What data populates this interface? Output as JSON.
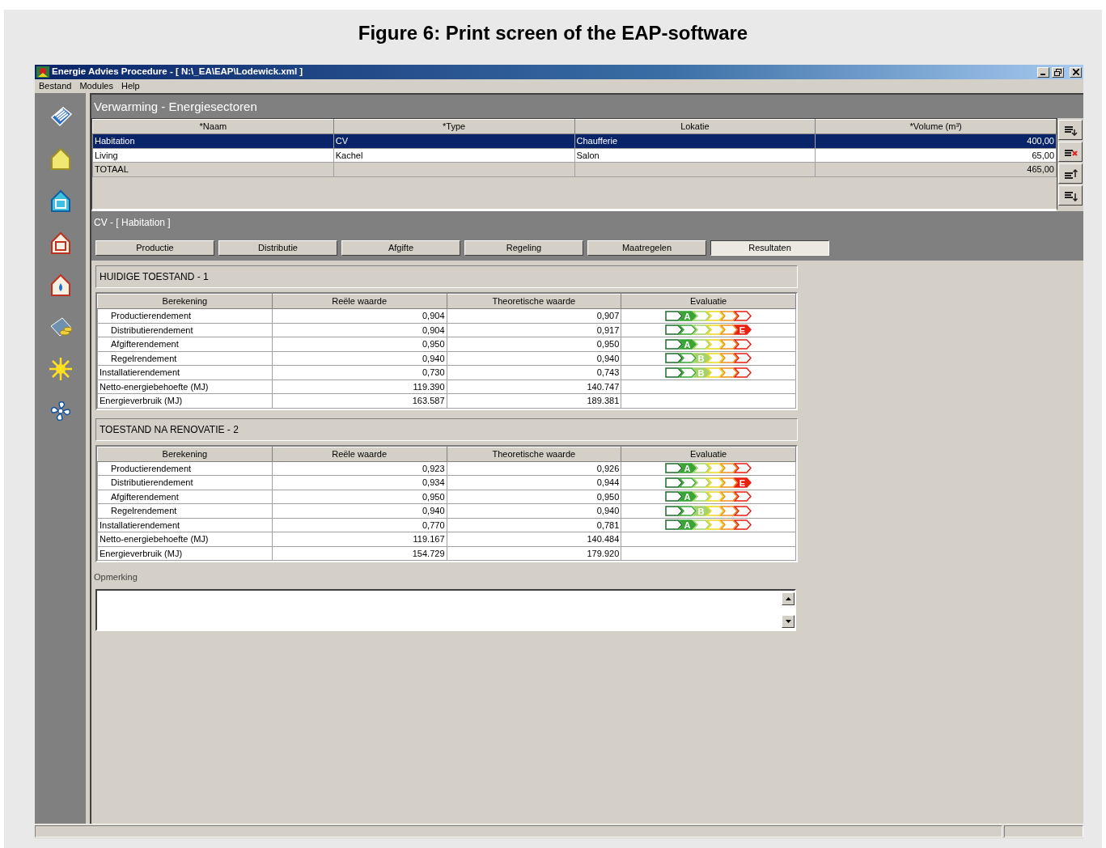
{
  "figure_caption": "Figure 6: Print screen of the EAP-software",
  "window": {
    "title": "Energie Advies Procedure - [ N:\\_EA\\EAP\\Lodewick.xml ]"
  },
  "menu": [
    "Bestand",
    "Modules",
    "Help"
  ],
  "sidebar": {
    "items": [
      {
        "kind": "cards"
      },
      {
        "kind": "house"
      },
      {
        "kind": "house-frame"
      },
      {
        "kind": "house-red"
      },
      {
        "kind": "house-drop"
      },
      {
        "kind": "coins"
      },
      {
        "kind": "sun"
      },
      {
        "kind": "fan"
      }
    ]
  },
  "sector_panel": {
    "title": "Verwarming - Energiesectoren",
    "columns": [
      "*Naam",
      "*Type",
      "Lokatie",
      "*Volume (m³)"
    ],
    "rows": [
      {
        "kind": "data",
        "selected": true,
        "cells": [
          "Habitation",
          "CV",
          "Chaufferie",
          "400,00"
        ]
      },
      {
        "kind": "data",
        "selected": false,
        "cells": [
          "Living",
          "Kachel",
          "Salon",
          "65,00"
        ]
      },
      {
        "kind": "total",
        "selected": false,
        "cells": [
          "TOTAAL",
          "",
          "",
          "465,00"
        ]
      }
    ],
    "toolbar": [
      {
        "kind": "add"
      },
      {
        "kind": "delete"
      },
      {
        "kind": "up"
      },
      {
        "kind": "down"
      }
    ]
  },
  "detail": {
    "title": "CV - [ Habitation ]",
    "tabs": [
      {
        "label": "Productie",
        "selected": false
      },
      {
        "label": "Distributie",
        "selected": false
      },
      {
        "label": "Afgifte",
        "selected": false
      },
      {
        "label": "Regeling",
        "selected": false
      },
      {
        "label": "Maatregelen",
        "selected": false
      },
      {
        "label": "Resultaten",
        "selected": true
      }
    ]
  },
  "sections": [
    {
      "title": "HUIDIGE TOESTAND - 1",
      "columns": [
        "Berekening",
        "Reële waarde",
        "Theoretische waarde",
        "Evaluatie"
      ],
      "rows": [
        {
          "kind": "sub",
          "cells": [
            "Productierendement",
            "0,904",
            "0,907"
          ],
          "evaluation": [
            {
              "selected": false
            },
            {
              "selected": true,
              "label": "A"
            },
            {
              "selected": false
            },
            {
              "selected": false
            },
            {
              "selected": false
            },
            {
              "selected": false
            }
          ]
        },
        {
          "kind": "sub",
          "cells": [
            "Distributierendement",
            "0,904",
            "0,917"
          ],
          "evaluation": [
            {
              "selected": false
            },
            {
              "selected": false
            },
            {
              "selected": false
            },
            {
              "selected": false
            },
            {
              "selected": false
            },
            {
              "selected": true,
              "label": "E"
            }
          ]
        },
        {
          "kind": "sub",
          "cells": [
            "Afgifterendement",
            "0,950",
            "0,950"
          ],
          "evaluation": [
            {
              "selected": false
            },
            {
              "selected": true,
              "label": "A"
            },
            {
              "selected": false
            },
            {
              "selected": false
            },
            {
              "selected": false
            },
            {
              "selected": false
            }
          ]
        },
        {
          "kind": "sub",
          "cells": [
            "Regelrendement",
            "0,940",
            "0,940"
          ],
          "evaluation": [
            {
              "selected": false
            },
            {
              "selected": false
            },
            {
              "selected": true,
              "label": "B"
            },
            {
              "selected": false
            },
            {
              "selected": false
            },
            {
              "selected": false
            }
          ]
        },
        {
          "kind": "main",
          "cells": [
            "Installatierendement",
            "0,730",
            "0,743"
          ],
          "evaluation": [
            {
              "selected": false
            },
            {
              "selected": false
            },
            {
              "selected": true,
              "label": "B"
            },
            {
              "selected": false
            },
            {
              "selected": false
            },
            {
              "selected": false
            }
          ]
        },
        {
          "kind": "main",
          "cells": [
            "Netto-energiebehoefte (MJ)",
            "119.390",
            "140.747"
          ]
        },
        {
          "kind": "main",
          "cells": [
            "Energieverbruik (MJ)",
            "163.587",
            "189.381"
          ]
        }
      ]
    },
    {
      "title": "TOESTAND NA RENOVATIE - 2",
      "columns": [
        "Berekening",
        "Reële waarde",
        "Theoretische waarde",
        "Evaluatie"
      ],
      "rows": [
        {
          "kind": "sub",
          "cells": [
            "Productierendement",
            "0,923",
            "0,926"
          ],
          "evaluation": [
            {
              "selected": false
            },
            {
              "selected": true,
              "label": "A"
            },
            {
              "selected": false
            },
            {
              "selected": false
            },
            {
              "selected": false
            },
            {
              "selected": false
            }
          ]
        },
        {
          "kind": "sub",
          "cells": [
            "Distributierendement",
            "0,934",
            "0,944"
          ],
          "evaluation": [
            {
              "selected": false
            },
            {
              "selected": false
            },
            {
              "selected": false
            },
            {
              "selected": false
            },
            {
              "selected": false
            },
            {
              "selected": true,
              "label": "E"
            }
          ]
        },
        {
          "kind": "sub",
          "cells": [
            "Afgifterendement",
            "0,950",
            "0,950"
          ],
          "evaluation": [
            {
              "selected": false
            },
            {
              "selected": true,
              "label": "A"
            },
            {
              "selected": false
            },
            {
              "selected": false
            },
            {
              "selected": false
            },
            {
              "selected": false
            }
          ]
        },
        {
          "kind": "sub",
          "cells": [
            "Regelrendement",
            "0,940",
            "0,940"
          ],
          "evaluation": [
            {
              "selected": false
            },
            {
              "selected": false
            },
            {
              "selected": true,
              "label": "B"
            },
            {
              "selected": false
            },
            {
              "selected": false
            },
            {
              "selected": false
            }
          ]
        },
        {
          "kind": "main",
          "cells": [
            "Installatierendement",
            "0,770",
            "0,781"
          ],
          "evaluation": [
            {
              "selected": false
            },
            {
              "selected": true,
              "label": "A"
            },
            {
              "selected": false
            },
            {
              "selected": false
            },
            {
              "selected": false
            },
            {
              "selected": false
            }
          ]
        },
        {
          "kind": "main",
          "cells": [
            "Netto-energiebehoefte (MJ)",
            "119.167",
            "140.484"
          ]
        },
        {
          "kind": "main",
          "cells": [
            "Energieverbruik (MJ)",
            "154.729",
            "179.920"
          ]
        }
      ]
    }
  ],
  "remark": {
    "label": "Opmerking"
  }
}
